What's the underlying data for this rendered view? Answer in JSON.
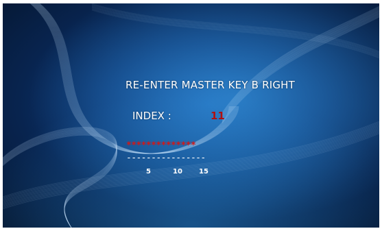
{
  "screen": {
    "title": "RE-ENTER MASTER KEY B RIGHT",
    "index_label": "INDEX :",
    "index_value": "11",
    "key_entry": "**************",
    "key_dashes": "----------------",
    "position_ticks": [
      "5",
      "10",
      "15"
    ]
  },
  "colors": {
    "text": "#ffffff",
    "entered_key": "#d01818",
    "index_value": "#b01010",
    "background": "#0e3b7a"
  }
}
